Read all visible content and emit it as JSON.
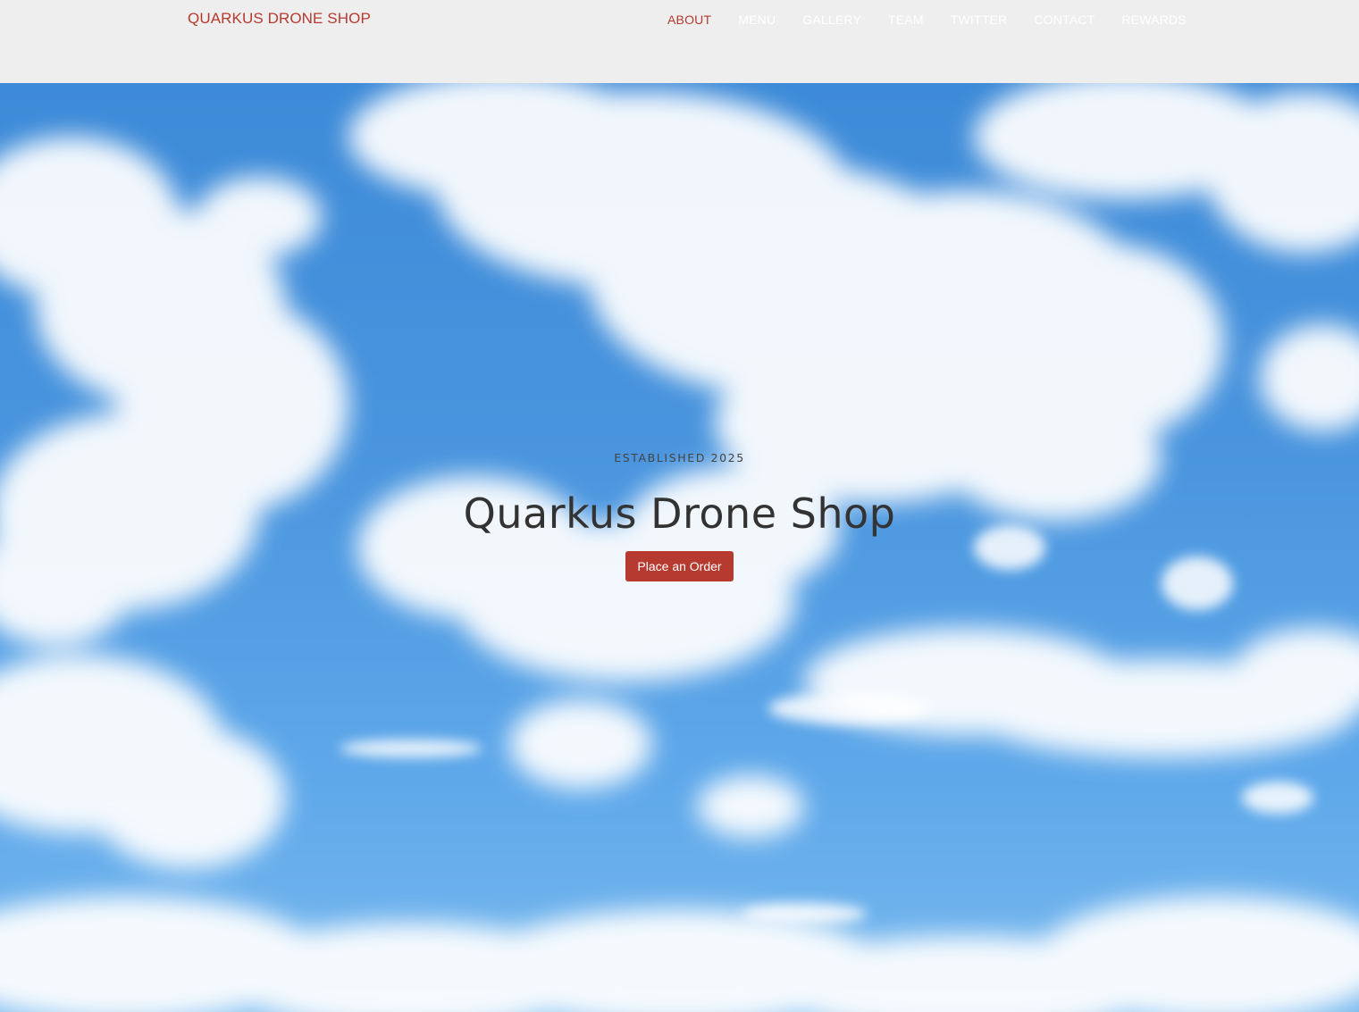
{
  "navbar": {
    "brand": "QUARKUS DRONE SHOP",
    "items": [
      {
        "label": "ABOUT",
        "active": true
      },
      {
        "label": "MENU",
        "active": false
      },
      {
        "label": "GALLERY",
        "active": false
      },
      {
        "label": "TEAM",
        "active": false
      },
      {
        "label": "TWITTER",
        "active": false
      },
      {
        "label": "CONTACT",
        "active": false
      },
      {
        "label": "REWARDS",
        "active": false
      }
    ]
  },
  "hero": {
    "eyebrow": "ESTABLISHED 2025",
    "title": "Quarkus Drone Shop",
    "cta_label": "Place an Order",
    "background": "sky-with-clouds"
  },
  "colors": {
    "accent": "#b63a2f",
    "navbar_bg": "#eeeeee",
    "sky": "#4a95de"
  }
}
